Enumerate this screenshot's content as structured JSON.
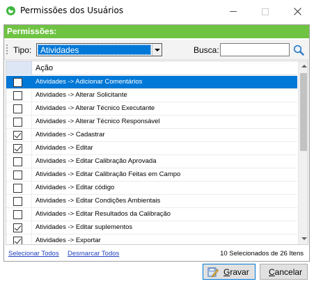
{
  "window": {
    "title": "Permissões dos Usuários",
    "accent_color": "#6fc342",
    "selection_color": "#0078d7"
  },
  "panel": {
    "header": "Permissões:"
  },
  "toolbar": {
    "tipo_label": "Tipo:",
    "tipo_value": "Atividades",
    "busca_label": "Busca:",
    "busca_value": ""
  },
  "grid": {
    "column_header": "Ação",
    "rows": [
      {
        "label": "Atividades -> Adicionar Comentários",
        "checked": false,
        "selected": true
      },
      {
        "label": "Atividades -> Alterar Solicitante",
        "checked": false,
        "selected": false
      },
      {
        "label": "Atividades -> Alterar Técnico Executante",
        "checked": false,
        "selected": false
      },
      {
        "label": "Atividades -> Alterar Técnico Responsável",
        "checked": false,
        "selected": false
      },
      {
        "label": "Atividades -> Cadastrar",
        "checked": true,
        "selected": false
      },
      {
        "label": "Atividades -> Editar",
        "checked": true,
        "selected": false
      },
      {
        "label": "Atividades -> Editar Calibração Aprovada",
        "checked": false,
        "selected": false
      },
      {
        "label": "Atividades -> Editar Calibração Feitas em Campo",
        "checked": false,
        "selected": false
      },
      {
        "label": "Atividades -> Editar código",
        "checked": false,
        "selected": false
      },
      {
        "label": "Atividades -> Editar Condições Ambientais",
        "checked": false,
        "selected": false
      },
      {
        "label": "Atividades -> Editar Resultados da Calibração",
        "checked": false,
        "selected": false
      },
      {
        "label": "Atividades -> Editar suplementos",
        "checked": true,
        "selected": false
      },
      {
        "label": "Atividades -> Exportar",
        "checked": true,
        "selected": false
      }
    ]
  },
  "footer": {
    "select_all": "Selecionar Todos",
    "deselect_all": "Desmarcar Todos",
    "count_text": "10 Selecionados de 26 Itens"
  },
  "buttons": {
    "save_underline": "G",
    "save_rest": "ravar",
    "cancel_underline": "C",
    "cancel_rest": "ancelar"
  }
}
